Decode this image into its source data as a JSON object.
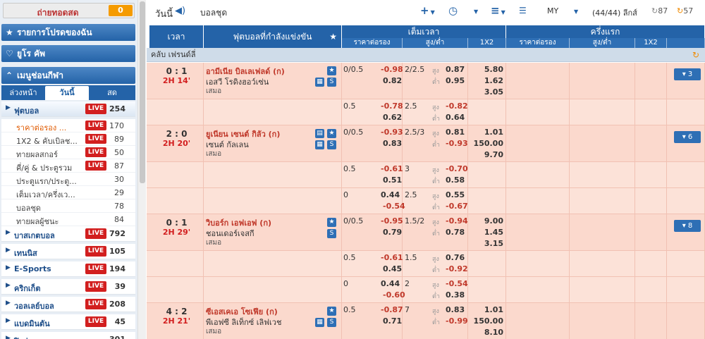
{
  "sidebar": {
    "bet_label": "ถ่ายทอดสด",
    "bet_count": "0",
    "favorites": "รายการโปรดของฉัน",
    "euro": "ยูโร คัพ",
    "menu": "เมนูช่อนกีฬา",
    "tabs": [
      "ล่วงหน้า",
      "วันนี้",
      "สด"
    ],
    "items": [
      {
        "type": "sport",
        "name": "ฟุตบอล",
        "live": "LIVE",
        "count": "254"
      },
      {
        "type": "sub",
        "name": "ราคาต่อรอง ...",
        "live": "LIVE",
        "count": "170",
        "active": true
      },
      {
        "type": "sub",
        "name": "1X2 & คับเบิลช...",
        "live": "LIVE",
        "count": "89"
      },
      {
        "type": "sub",
        "name": "ทายผลสกอร์",
        "live": "LIVE",
        "count": "50"
      },
      {
        "type": "sub",
        "name": "คี่/คู่ & ประตูรวม",
        "live": "LIVE",
        "count": "87"
      },
      {
        "type": "sub",
        "name": "ประตูแรก/ประตู...",
        "live": "",
        "count": "30"
      },
      {
        "type": "sub",
        "name": "เต็มเวลา/ครึ่งเว...",
        "live": "",
        "count": "29"
      },
      {
        "type": "sub",
        "name": "บอลชุด",
        "live": "",
        "count": "78"
      },
      {
        "type": "sub",
        "name": "ทายผลผู้ชนะ",
        "live": "",
        "count": "84"
      },
      {
        "type": "sport",
        "name": "บาสเกตบอล",
        "live": "LIVE",
        "count": "792"
      },
      {
        "type": "sport",
        "name": "เทนนิส",
        "live": "LIVE",
        "count": "105"
      },
      {
        "type": "sport",
        "name": "E-Sports",
        "live": "LIVE",
        "count": "194"
      },
      {
        "type": "sport",
        "name": "คริกเก็ต",
        "live": "LIVE",
        "count": "39"
      },
      {
        "type": "sport",
        "name": "วอลเลย์บอล",
        "live": "LIVE",
        "count": "208"
      },
      {
        "type": "sport",
        "name": "แบดมินตัน",
        "live": "LIVE",
        "count": "45"
      },
      {
        "type": "sport",
        "name": "ปิงปอง",
        "live": "",
        "count": "301"
      }
    ]
  },
  "topbar": {
    "today": "วันนี้",
    "category": "บอลชุด",
    "odds_type": "MY",
    "count": "(44/44) ลีกส์",
    "c1": "87",
    "c2": "57"
  },
  "header": {
    "time": "เวลา",
    "match": "ฟุตบอลที่กำลังแข่งขัน",
    "fulltime": "เต็มเวลา",
    "firsthalf": "ครึ่งแรก",
    "hdp": "ราคาต่อรอง",
    "ou": "สูง/ต่ำ",
    "x12": "1X2"
  },
  "league": "คลับ เฟรนด์ลี่",
  "ou_labels": {
    "over": "สูง",
    "under": "ต่ำ"
  },
  "matches": [
    {
      "score": "0 : 1",
      "live": "2H 14'",
      "home": "อามีเนีย บิลเลเฟลด์ (ก)",
      "away": "เอสวี โรดิงฮอว์เซ่น",
      "draw": "เสมอ",
      "more": "▾ 3",
      "icons": "tv",
      "lines": [
        {
          "hdp": "0/0.5",
          "h1": "-0.98",
          "h2": "0.82",
          "ou": "2/2.5",
          "o1": "0.87",
          "o2": "0.95",
          "x": [
            "5.80",
            "1.62",
            "3.05"
          ]
        },
        {
          "hdp": "0.5",
          "h1": "-0.78",
          "h2": "0.62",
          "ou": "2.5",
          "o1": "-0.82",
          "o2": "0.64",
          "x": []
        }
      ]
    },
    {
      "score": "2 : 0",
      "live": "2H 20'",
      "home": "ยูเนียน เซนต์ กิลัว (ก)",
      "away": "เซนต์ กัลเลน",
      "draw": "เสมอ",
      "more": "▾ 6",
      "icons": "tv2",
      "lines": [
        {
          "hdp": "0/0.5",
          "h1": "-0.93",
          "h2": "0.83",
          "ou": "2.5/3",
          "o1": "0.81",
          "o2": "-0.93",
          "x": [
            "1.01",
            "150.00",
            "9.70"
          ]
        },
        {
          "hdp": "0.5",
          "h1": "-0.61",
          "h2": "0.51",
          "ou": "3",
          "o1": "-0.70",
          "o2": "0.58",
          "x": []
        },
        {
          "hdp": "0",
          "h1": "0.44",
          "h2": "-0.54",
          "ou": "2.5",
          "o1": "0.55",
          "o2": "-0.67",
          "x": []
        }
      ]
    },
    {
      "score": "0 : 1",
      "live": "2H 29'",
      "home": "วิบอร์ก เอฟเอฟ (ก)",
      "away": "ชอนเดอร์เจสกี",
      "draw": "เสมอ",
      "more": "▾ 8",
      "icons": "",
      "lines": [
        {
          "hdp": "0/0.5",
          "h1": "-0.95",
          "h2": "0.79",
          "ou": "1.5/2",
          "o1": "-0.94",
          "o2": "0.78",
          "x": [
            "9.00",
            "1.45",
            "3.15"
          ]
        },
        {
          "hdp": "0.5",
          "h1": "-0.61",
          "h2": "0.45",
          "ou": "1.5",
          "o1": "0.76",
          "o2": "-0.92",
          "x": []
        },
        {
          "hdp": "0",
          "h1": "0.44",
          "h2": "-0.60",
          "ou": "2",
          "o1": "-0.54",
          "o2": "0.38",
          "x": []
        }
      ]
    },
    {
      "score": "4 : 2",
      "live": "2H 21'",
      "home": "ซีเอสเคเอ โซเฟีย (ก)",
      "away": "พีเอฟซี ลิเท็กซ์ เลิฟเวช",
      "draw": "เสมอ",
      "more": "",
      "icons": "tv",
      "lines": [
        {
          "hdp": "0.5",
          "h1": "-0.87",
          "h2": "0.71",
          "ou": "7",
          "o1": "0.83",
          "o2": "-0.99",
          "x": [
            "1.01",
            "150.00",
            "8.10"
          ]
        }
      ]
    }
  ]
}
